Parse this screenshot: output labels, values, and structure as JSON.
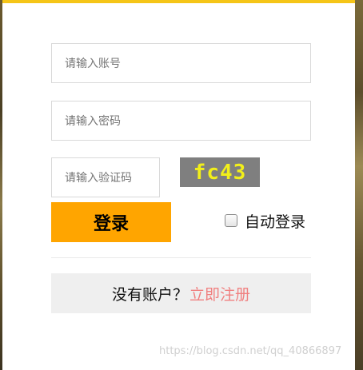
{
  "form": {
    "account_placeholder": "请输入账号",
    "password_placeholder": "请输入密码",
    "captcha_placeholder": "请输入验证码",
    "captcha_code": "fc43",
    "login_label": "登录",
    "auto_login_label": "自动登录",
    "auto_login_checked": false
  },
  "register": {
    "prompt": "没有账户？",
    "link_label": "立即注册"
  },
  "watermark": "https://blog.csdn.net/qq_40866897",
  "colors": {
    "accent_top": "#f5c518",
    "login_button": "#ffa500",
    "register_link": "#f08080",
    "captcha_bg": "#7f7f7f",
    "captcha_text": "#f2ef1a"
  }
}
